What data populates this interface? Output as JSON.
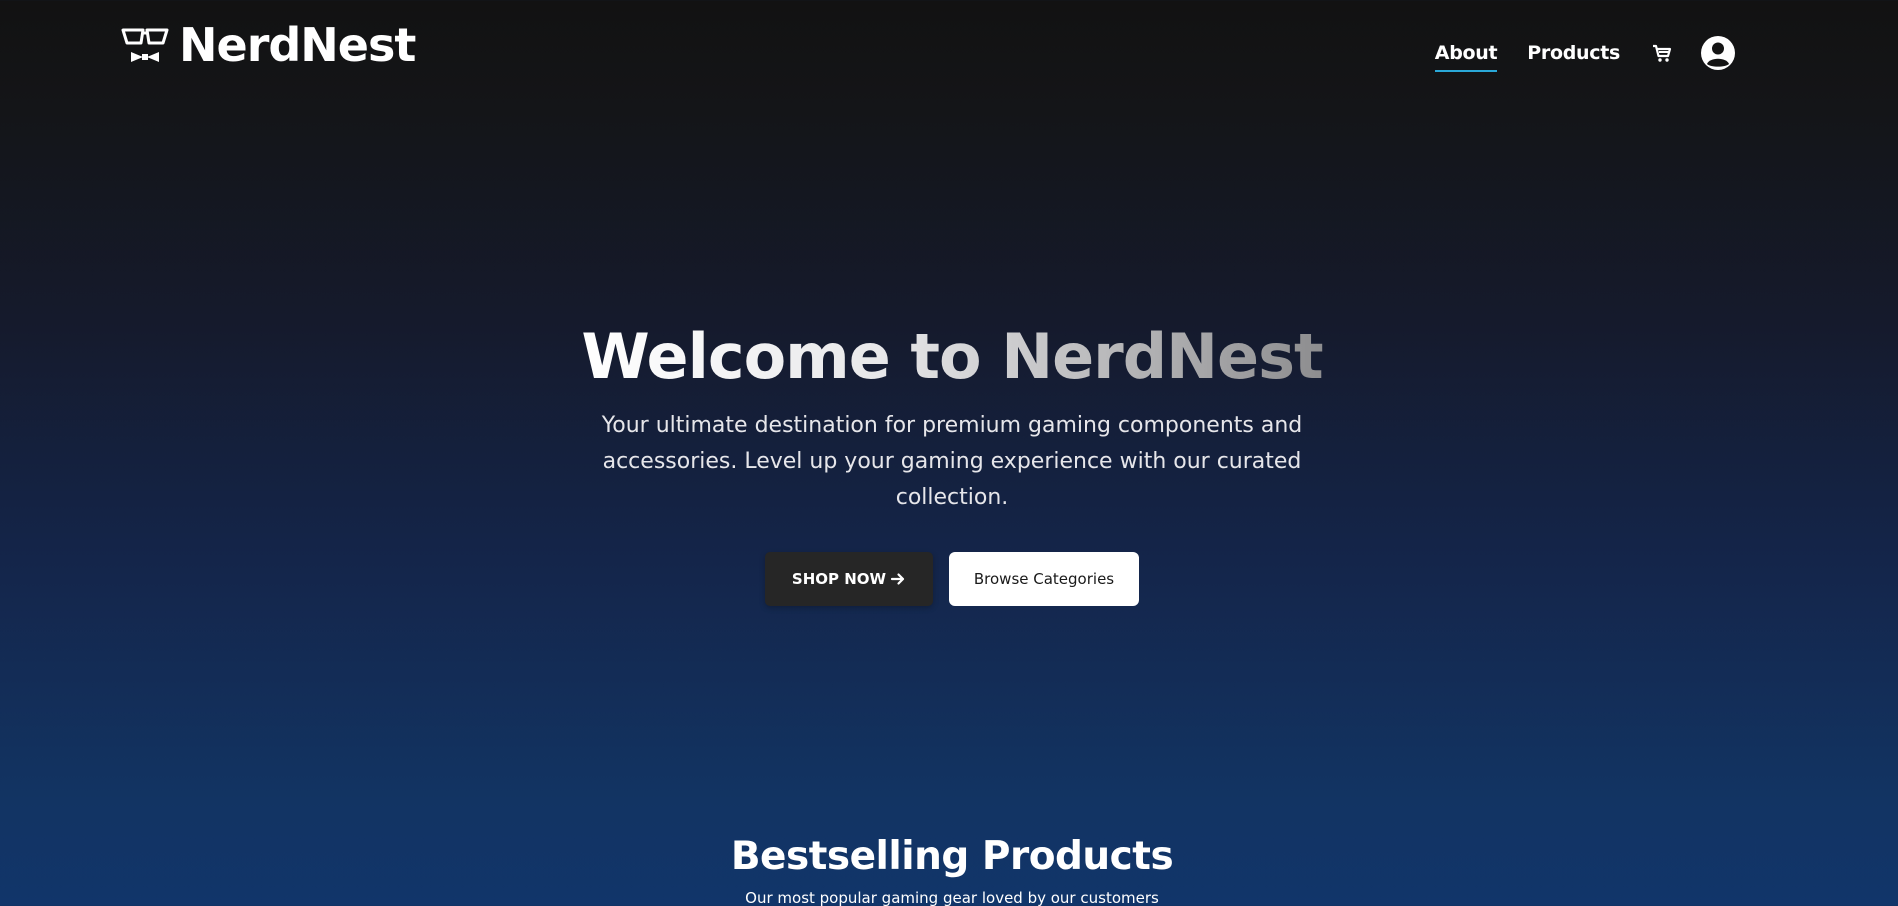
{
  "brand": {
    "name": "NerdNest",
    "logo_icon": "nerd-glasses-bowtie-icon"
  },
  "nav": {
    "links": [
      {
        "label": "About",
        "active": true
      },
      {
        "label": "Products",
        "active": false
      }
    ],
    "cart_icon": "cart-icon",
    "account_icon": "user-account-icon",
    "accent_color": "#2aa8d8"
  },
  "hero": {
    "title": "Welcome to NerdNest",
    "subtitle": "Your ultimate destination for premium gaming components and accessories. Level up your gaming experience with our curated collection.",
    "primary_button": "SHOP NOW",
    "primary_button_icon": "arrow-right-icon",
    "secondary_button": "Browse Categories"
  },
  "bestselling": {
    "title": "Bestselling Products",
    "subtitle": "Our most popular gaming gear loved by our customers"
  },
  "colors": {
    "header_bg": "#121212",
    "gradient_bottom": "#11356a",
    "primary_button_bg": "#262626",
    "secondary_button_bg": "#ffffff"
  }
}
